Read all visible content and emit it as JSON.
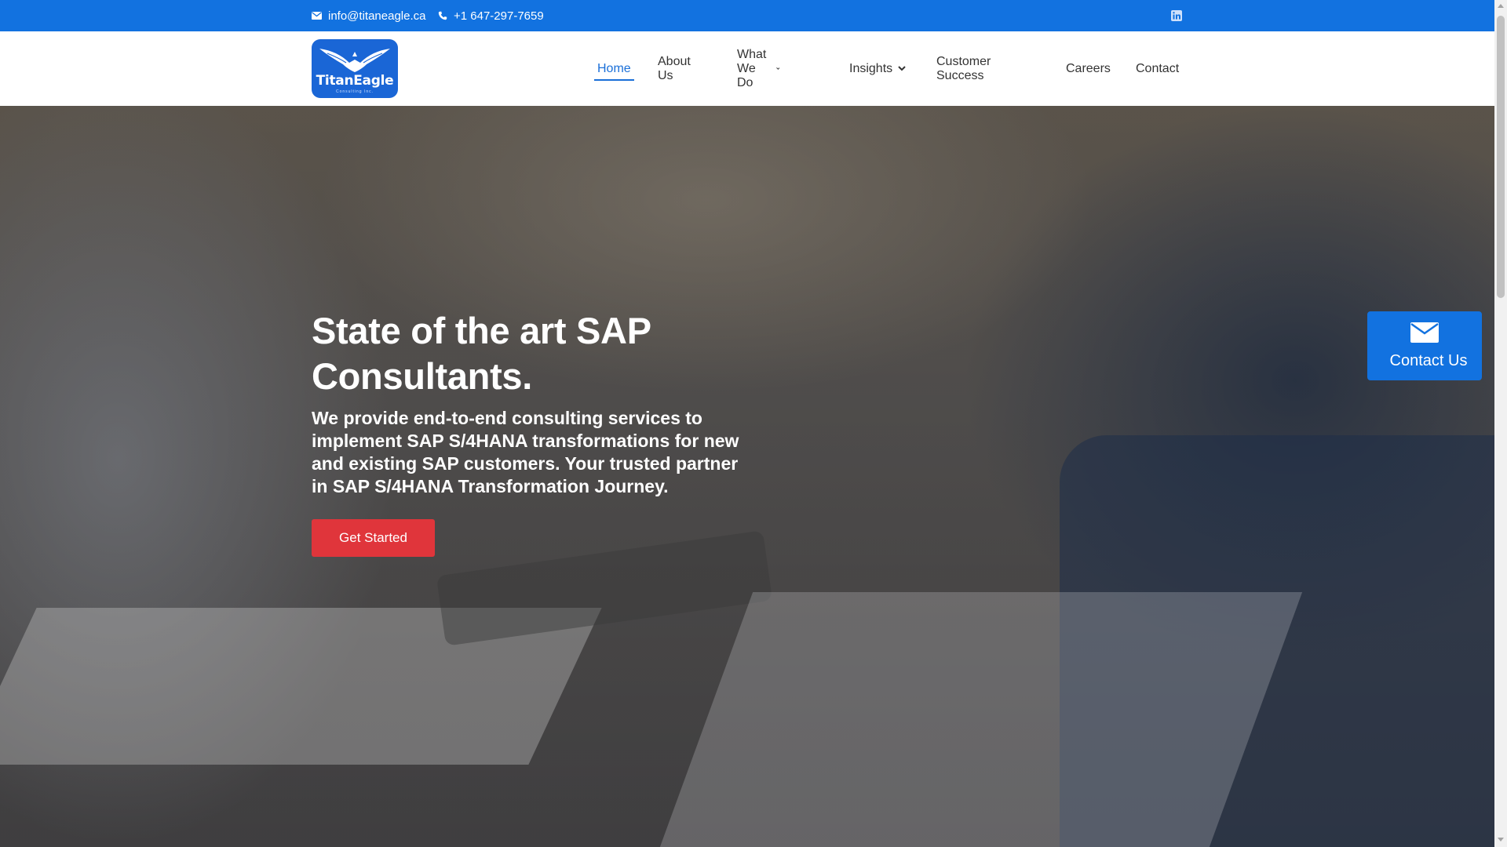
{
  "topbar": {
    "email": "info@titaneagle.ca",
    "phone": "+1 647-297-7659",
    "email_icon": "envelope-icon",
    "phone_icon": "phone-icon",
    "social_icon": "linkedin-icon",
    "background": "#1272e0"
  },
  "logo": {
    "text": "TitanEagle",
    "subtext": "Consulting Inc.",
    "background": "#1a66d6"
  },
  "nav": {
    "items": [
      {
        "label": "Home",
        "active": true
      },
      {
        "label": "About Us"
      },
      {
        "label": "What We Do",
        "dropdown": true
      },
      {
        "label": "Insights",
        "dropdown": true
      },
      {
        "label": "Customer Success"
      },
      {
        "label": "Careers"
      },
      {
        "label": "Contact"
      }
    ],
    "active_color": "#1a6fd8"
  },
  "hero": {
    "title_line1": "State of the art SAP",
    "title_line2": "Consultants.",
    "description": "We provide end-to-end consulting services to implement SAP S/4HANA transformations for new and existing SAP customers. Your trusted partner in SAP S/4HANA Transformation Journey.",
    "cta_label": "Get Started",
    "cta_color": "#e0353b"
  },
  "contact_float": {
    "label": "Contact Us",
    "icon": "envelope-icon"
  }
}
